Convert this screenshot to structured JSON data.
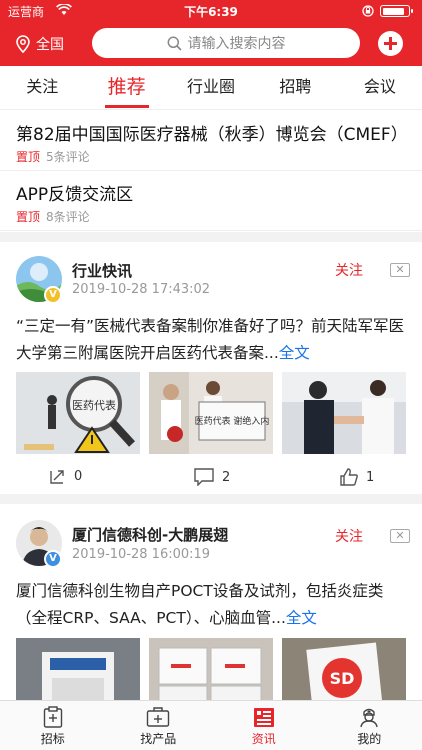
{
  "status_bar": {
    "carrier": "运营商",
    "time": "下午6:39",
    "battery_level": 0.9
  },
  "header": {
    "location": "全国",
    "search_placeholder": "请输入搜索内容"
  },
  "tabs": [
    {
      "label": "关注",
      "active": false
    },
    {
      "label": "推荐",
      "active": true
    },
    {
      "label": "行业圈",
      "active": false
    },
    {
      "label": "招聘",
      "active": false
    },
    {
      "label": "会议",
      "active": false
    }
  ],
  "pinned": [
    {
      "title": "第82届中国国际医疗器械（秋季）博览会（CMEF）",
      "tag": "置顶",
      "comments": "5条评论"
    },
    {
      "title": "APP反馈交流区",
      "tag": "置顶",
      "comments": "8条评论"
    }
  ],
  "posts": [
    {
      "author": "行业快讯",
      "time": "2019-10-28 17:43:02",
      "follow_label": "关注",
      "text": "“三定一有”医械代表备案制你准备好了吗？前天陆军军医大学第三附属医院开启医药代表备案...",
      "more_label": "全文",
      "image_texts": [
        "医药代表",
        "医药代表 谢绝入内"
      ],
      "shares": "0",
      "comments": "2",
      "likes": "1"
    },
    {
      "author": "厦门信德科创-大鹏展翅",
      "time": "2019-10-28 16:00:19",
      "follow_label": "关注",
      "text": "厦门信德科创生物自产POCT设备及试剂，包括炎症类（全程CRP、SAA、PCT）、心脑血管...",
      "more_label": "全文",
      "image_texts": [
        "SD"
      ]
    }
  ],
  "bottom_nav": [
    {
      "label": "招标",
      "icon": "clipboard-icon",
      "active": false
    },
    {
      "label": "找产品",
      "icon": "medkit-icon",
      "active": false
    },
    {
      "label": "资讯",
      "icon": "news-icon",
      "active": true
    },
    {
      "label": "我的",
      "icon": "nurse-icon",
      "active": false
    }
  ],
  "colors": {
    "brand": "#e7262b",
    "link": "#1a73e8"
  }
}
